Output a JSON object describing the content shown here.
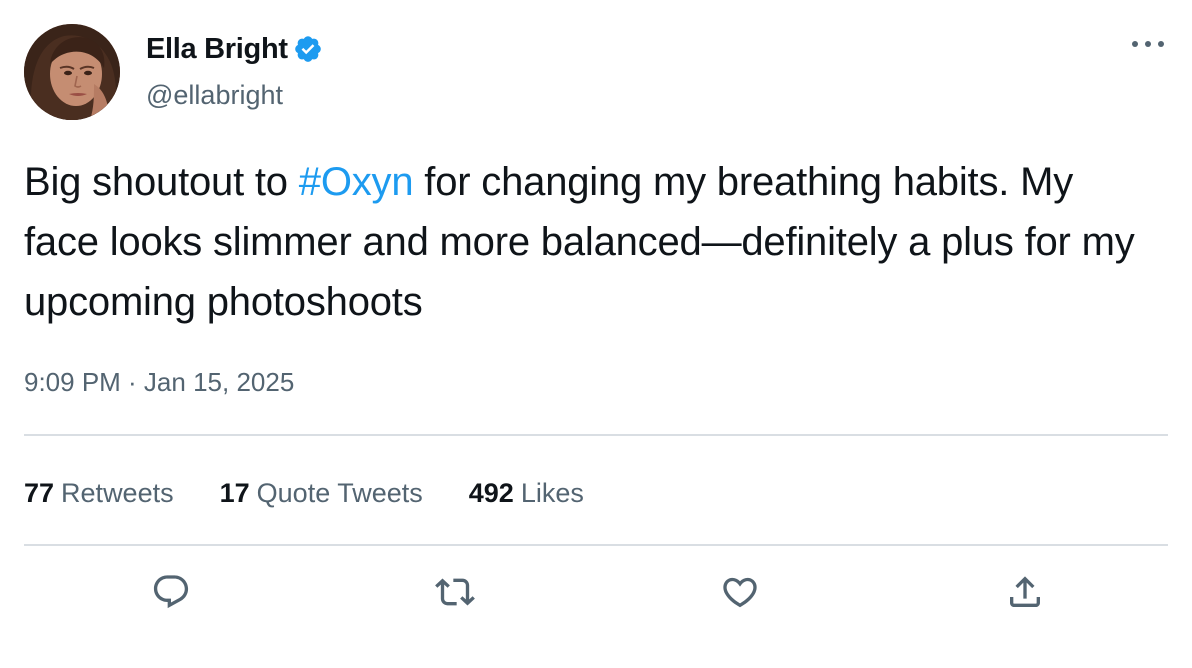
{
  "tweet": {
    "author": {
      "display_name": "Ella Bright",
      "handle": "@ellabright",
      "verified": true
    },
    "text": {
      "before_hashtag": "Big shoutout to ",
      "hashtag": "#Oxyn",
      "after_hashtag": " for changing my breathing habits. My face looks slimmer and more balanced—definitely a plus for my upcoming photoshoots"
    },
    "timestamp": "9:09 PM · Jan 15, 2025",
    "stats": {
      "retweets_count": "77",
      "retweets_label": "Retweets",
      "quotes_count": "17",
      "quotes_label": "Quote Tweets",
      "likes_count": "492",
      "likes_label": "Likes"
    },
    "actions": [
      "reply-icon",
      "retweet-icon",
      "like-icon",
      "share-icon"
    ]
  },
  "colors": {
    "accent": "#1d9bf0",
    "text_primary": "#0f1419",
    "text_secondary": "#536471",
    "divider": "#d9dee3"
  }
}
